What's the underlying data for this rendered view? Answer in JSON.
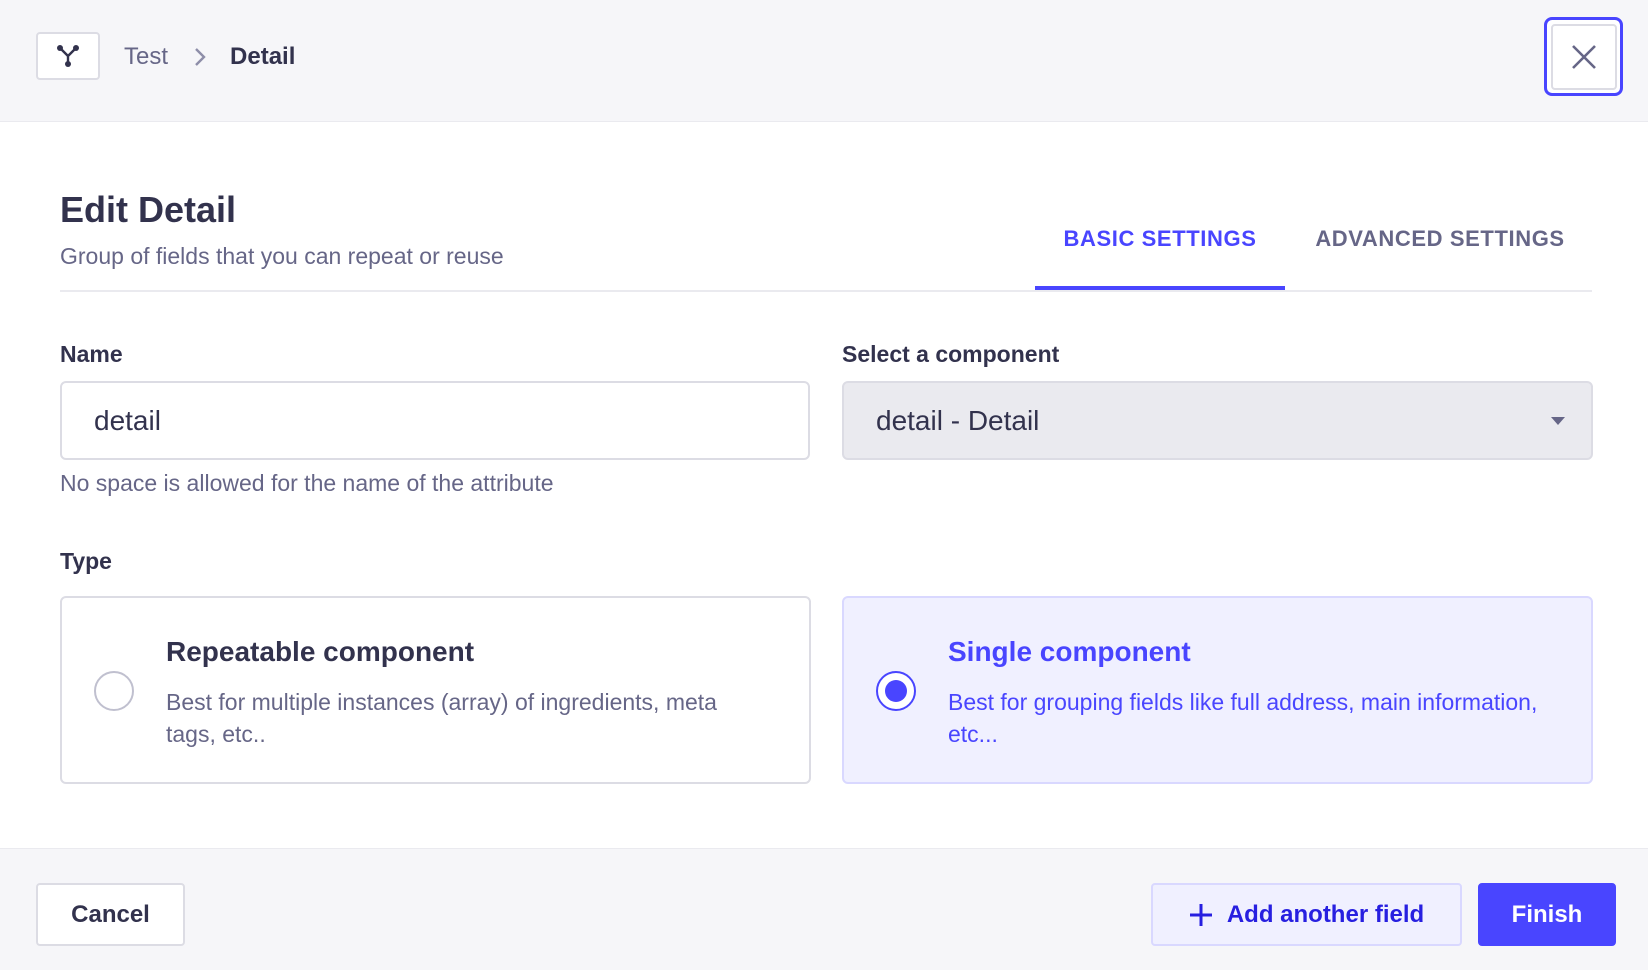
{
  "header": {
    "icon": "component-branch-icon",
    "breadcrumb": {
      "parent": "Test",
      "current": "Detail"
    },
    "close_icon": "close-icon"
  },
  "main": {
    "title": "Edit Detail",
    "subtitle": "Group of fields that you can repeat or reuse",
    "tabs": [
      {
        "label": "BASIC SETTINGS",
        "active": true
      },
      {
        "label": "ADVANCED SETTINGS",
        "active": false
      }
    ],
    "name_field": {
      "label": "Name",
      "value": "detail",
      "hint": "No space is allowed for the name of the attribute"
    },
    "component_select": {
      "label": "Select a component",
      "value": "detail - Detail"
    },
    "type": {
      "label": "Type",
      "options": [
        {
          "title": "Repeatable component",
          "description": "Best for multiple instances (array) of ingredients, meta tags, etc..",
          "selected": false
        },
        {
          "title": "Single component",
          "description": "Best for grouping fields like full address, main information, etc...",
          "selected": true
        }
      ]
    }
  },
  "footer": {
    "cancel_label": "Cancel",
    "add_label": "Add another field",
    "finish_label": "Finish"
  },
  "colors": {
    "primary": "#4945ff",
    "primary_light": "#f0f0ff",
    "text_dark": "#32324d",
    "text_muted": "#666687",
    "border": "#dcdce4"
  }
}
